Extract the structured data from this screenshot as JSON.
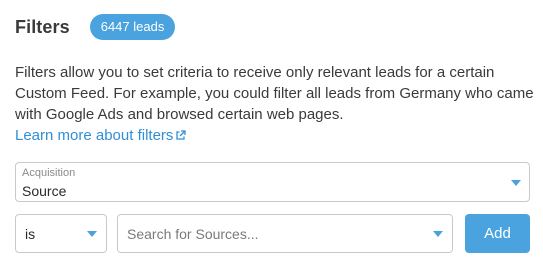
{
  "header": {
    "title": "Filters",
    "badge": "6447 leads"
  },
  "description": {
    "text": "Filters allow you to set criteria to receive only relevant leads for a certain Custom Feed. For example, you could filter all leads from Germany who came with Google Ads and browsed certain web pages.",
    "link_label": "Learn more about filters",
    "link_icon": "external-link-icon"
  },
  "acquisition_select": {
    "label": "Acquisition",
    "value": "Source"
  },
  "operator_select": {
    "value": "is"
  },
  "source_select": {
    "placeholder": "Search for Sources..."
  },
  "add_button": {
    "label": "Add"
  },
  "colors": {
    "accent": "#4aa3df",
    "link": "#2f8fd6",
    "text": "#3a3a3a",
    "border": "#c9c9c9"
  }
}
